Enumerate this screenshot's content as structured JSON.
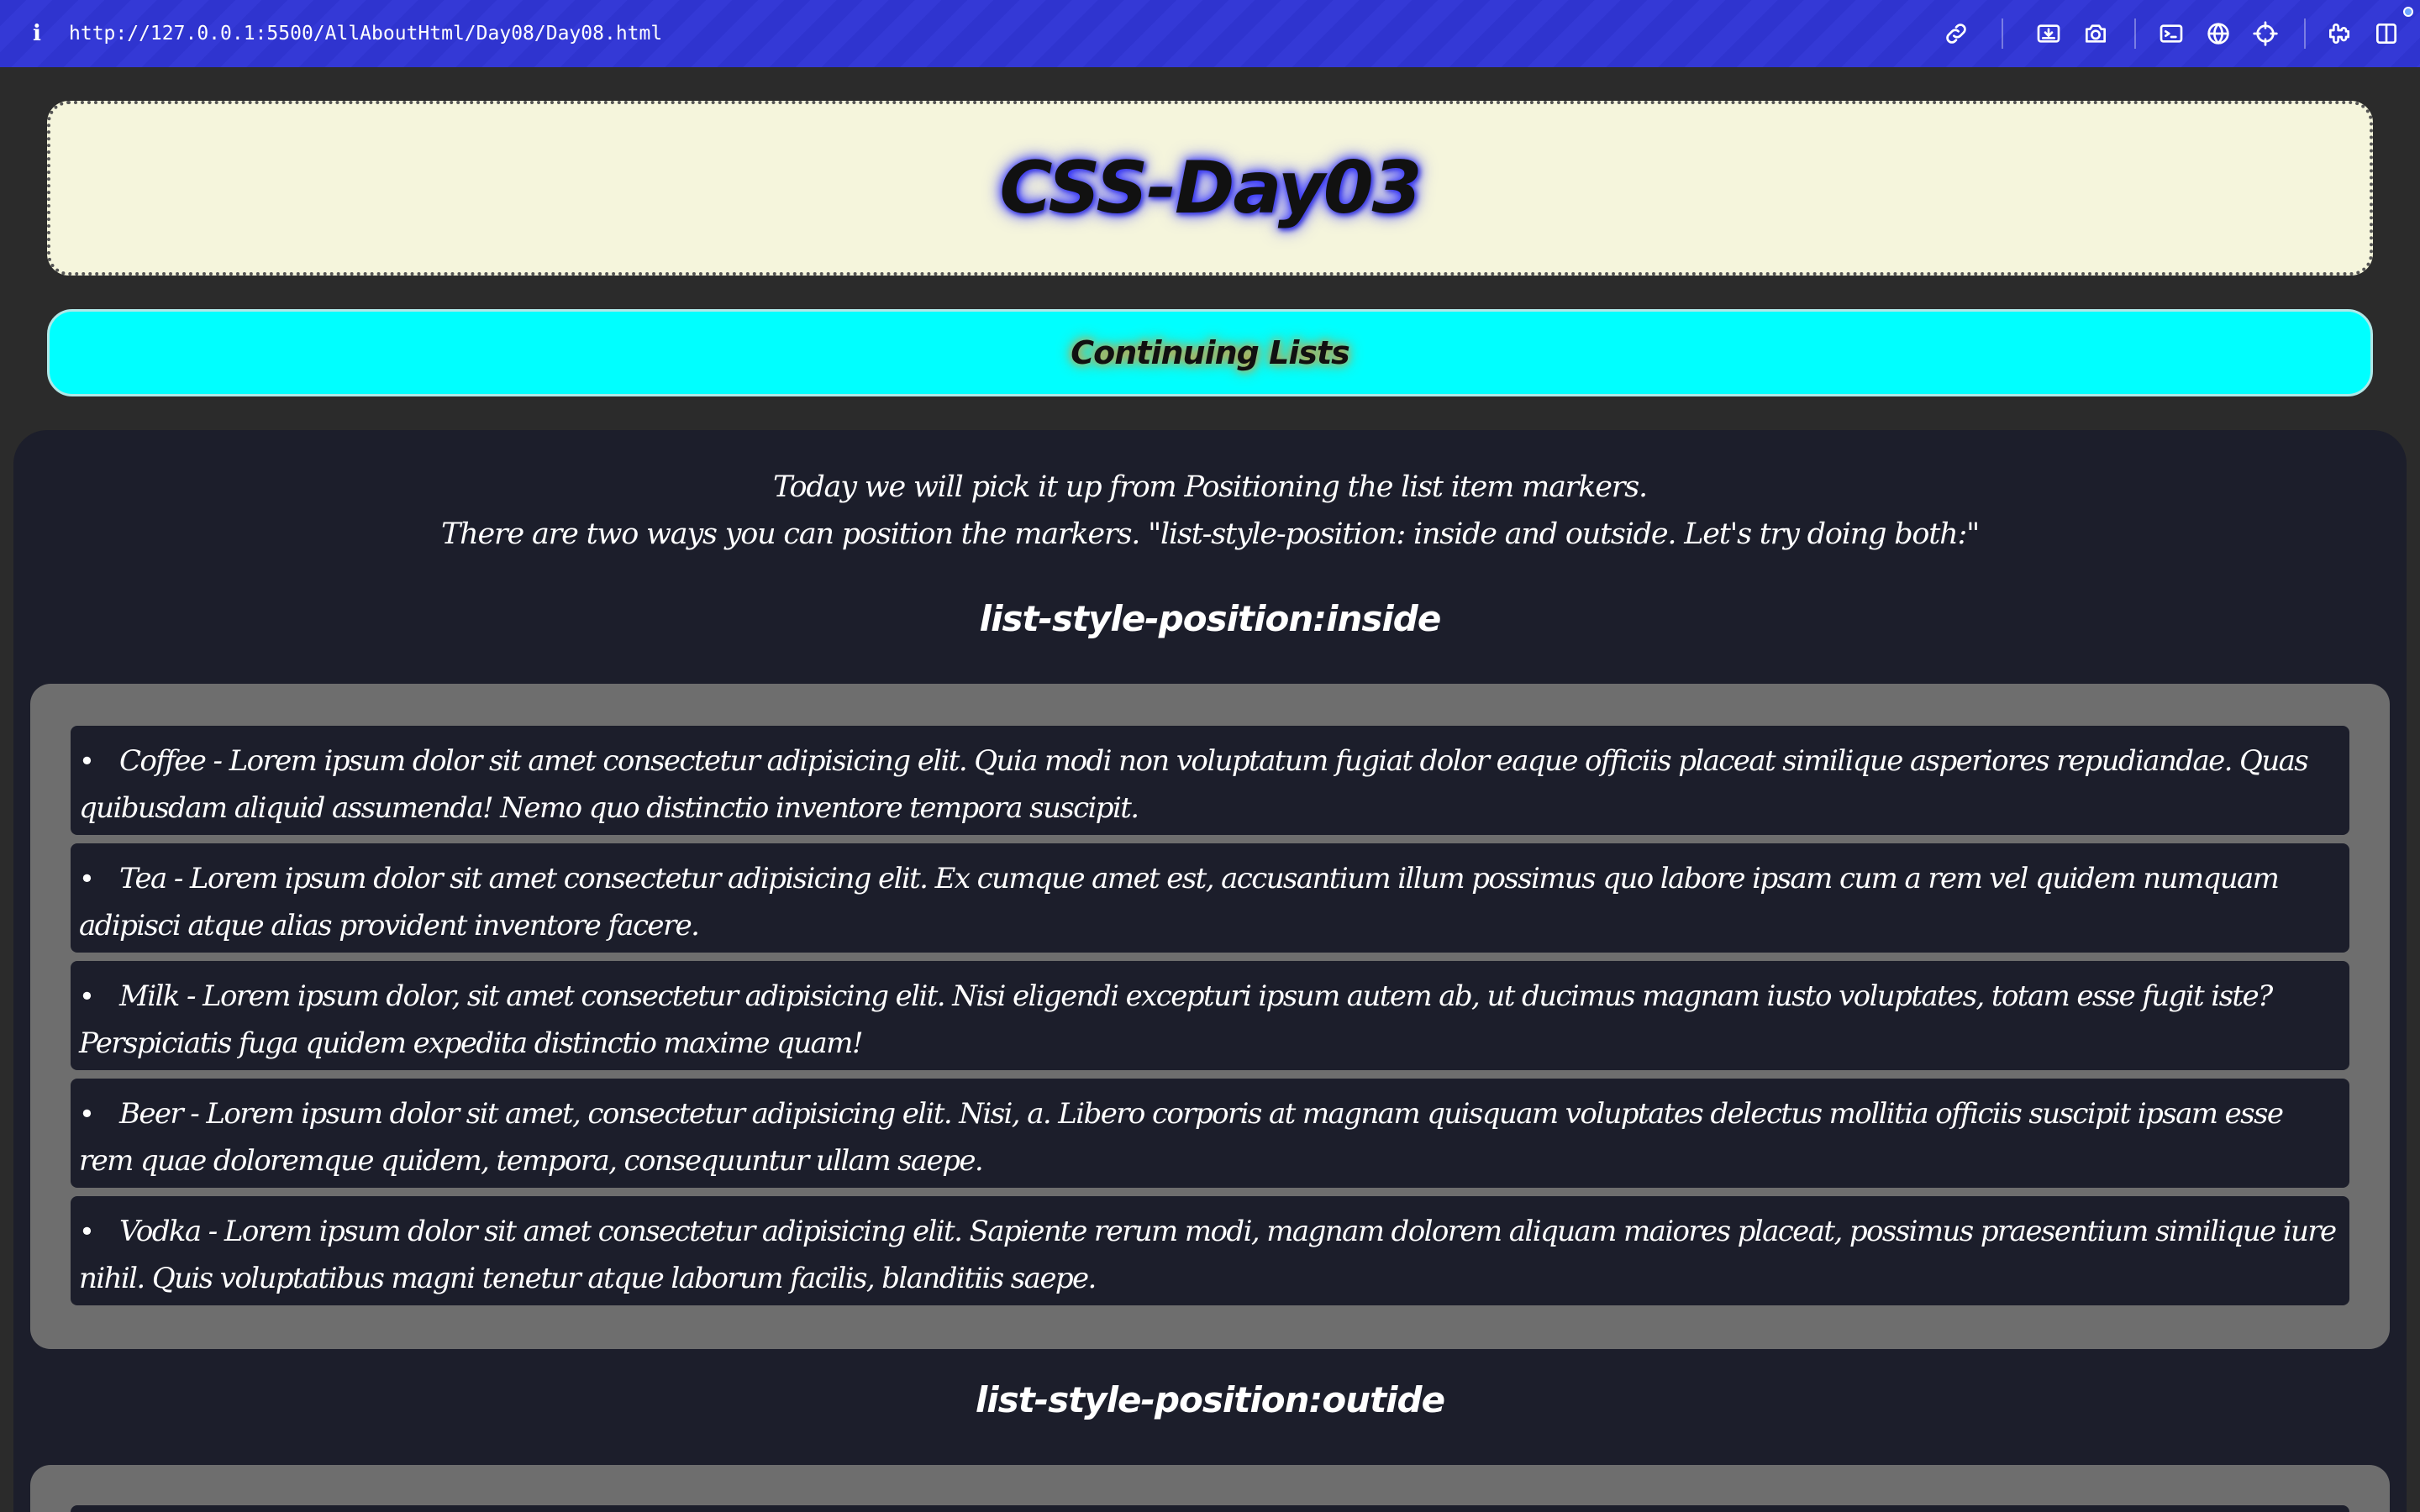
{
  "browser": {
    "info_icon": "i",
    "url": "http://127.0.0.1:5500/AllAboutHtml/Day08/Day08.html",
    "toolbar_icons": [
      "link-icon",
      "inbox-download-icon",
      "camera-icon",
      "terminal-icon",
      "globe-icon",
      "crosshair-icon",
      "extensions-icon",
      "sidebar-icon"
    ]
  },
  "header": {
    "title": "CSS-Day03"
  },
  "subheader": {
    "title": "Continuing Lists"
  },
  "intro": {
    "line1": "Today we will pick it up from Positioning the list item markers.",
    "line2": "There are two ways you can position the markers. \"list-style-position: inside and outside. Let's try doing both:\""
  },
  "sections": {
    "inside": {
      "heading": "list-style-position:inside",
      "items": [
        {
          "bullet": "•",
          "text": "Coffee - Lorem ipsum dolor sit amet consectetur adipisicing elit. Quia modi non voluptatum fugiat dolor eaque officiis placeat similique asperiores repudiandae. Quas quibusdam aliquid assumenda! Nemo quo distinctio inventore tempora suscipit."
        },
        {
          "bullet": "•",
          "text": "Tea - Lorem ipsum dolor sit amet consectetur adipisicing elit. Ex cumque amet est, accusantium illum possimus quo labore ipsam cum a rem vel quidem numquam adipisci atque alias provident inventore facere."
        },
        {
          "bullet": "•",
          "text": "Milk - Lorem ipsum dolor, sit amet consectetur adipisicing elit. Nisi eligendi excepturi ipsum autem ab, ut ducimus magnam iusto voluptates, totam esse fugit iste? Perspiciatis fuga quidem expedita distinctio maxime quam!"
        },
        {
          "bullet": "•",
          "text": "Beer - Lorem ipsum dolor sit amet, consectetur adipisicing elit. Nisi, a. Libero corporis at magnam quisquam voluptates delectus mollitia officiis suscipit ipsam esse rem quae doloremque quidem, tempora, consequuntur ullam saepe."
        },
        {
          "bullet": "•",
          "text": "Vodka - Lorem ipsum dolor sit amet consectetur adipisicing elit. Sapiente rerum modi, magnam dolorem aliquam maiores placeat, possimus praesentium similique iure nihil. Quis voluptatibus magni tenetur atque laborum facilis, blanditiis saepe."
        }
      ]
    },
    "outside": {
      "heading": "list-style-position:outide"
    }
  }
}
